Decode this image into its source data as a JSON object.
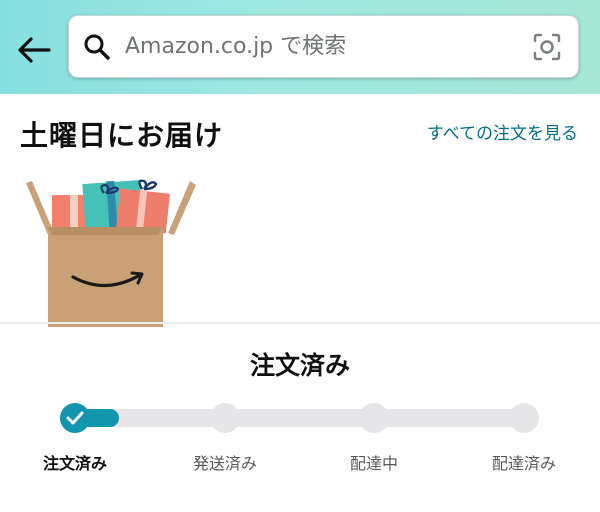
{
  "header": {
    "search_placeholder": "Amazon.co.jp で検索",
    "icons": [
      "back-arrow-icon",
      "search-icon",
      "camera-scan-icon"
    ]
  },
  "delivery": {
    "title": "土曜日にお届け",
    "see_all_orders": "すべての注文を見る"
  },
  "tracking": {
    "status_title": "注文済み",
    "progress": 0.1,
    "steps": [
      {
        "label": "注文済み",
        "state": "completed"
      },
      {
        "label": "発送済み",
        "state": "pending"
      },
      {
        "label": "配達中",
        "state": "pending"
      },
      {
        "label": "配達済み",
        "state": "pending"
      }
    ]
  },
  "colors": {
    "accent": "#1196ad",
    "link": "#007185",
    "header_gradient_start": "#86dfe0",
    "header_gradient_end": "#a6e7d6"
  }
}
